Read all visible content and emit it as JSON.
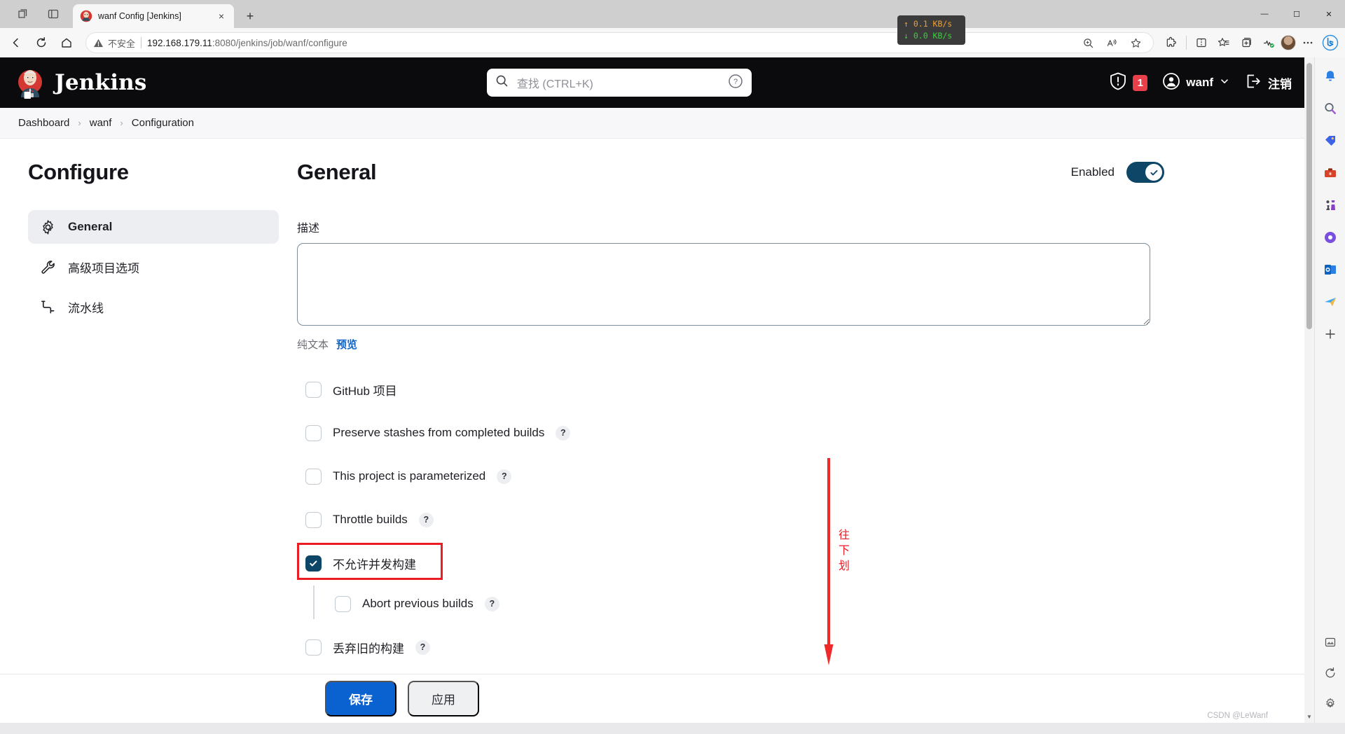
{
  "browser": {
    "tab": {
      "title": "wanf Config [Jenkins]",
      "favicon": "jenkins-icon",
      "close": "×"
    },
    "newtab_label": "+",
    "window_controls": {
      "minimize": "—",
      "maximize": "☐",
      "close": "✕"
    },
    "nav": {
      "back": "back-arrow-icon",
      "refresh": "refresh-icon",
      "home": "home-icon"
    },
    "omnibox": {
      "security_label": "不安全",
      "url_host": "192.168.179.11",
      "url_rest": ":8080/jenkins/job/wanf/configure"
    },
    "network_speed": {
      "upload": "↑ 0.1 KB/s",
      "download": "↓ 0.0 KB/s"
    },
    "toolbar_icons": [
      "zoom-icon",
      "read-aloud-icon",
      "favorite-star-icon",
      "extensions-icon",
      "split-screen-icon",
      "favorites-list-icon",
      "collections-icon",
      "browser-essentials-icon",
      "profile-avatar",
      "settings-more-icon",
      "bing-copilot-icon"
    ]
  },
  "jenkins": {
    "brand": "Jenkins",
    "search": {
      "placeholder": "查找 (CTRL+K)",
      "help": "?"
    },
    "alert_count": "1",
    "user": "wanf",
    "logout": "注销",
    "breadcrumb": [
      "Dashboard",
      "wanf",
      "Configuration"
    ],
    "breadcrumb_sep": "›"
  },
  "sidebar": {
    "title": "Configure",
    "items": [
      {
        "label": "General",
        "icon": "gear-icon",
        "active": true
      },
      {
        "label": "高级项目选项",
        "icon": "wrench-icon",
        "active": false
      },
      {
        "label": "流水线",
        "icon": "pipeline-icon",
        "active": false
      }
    ]
  },
  "main": {
    "heading": "General",
    "enabled_label": "Enabled",
    "enabled_state": true,
    "description_label": "描述",
    "description_value": "",
    "description_plain": "纯文本",
    "description_preview": "预览",
    "checkboxes": [
      {
        "label": "GitHub 项目",
        "checked": false,
        "help": false,
        "nested": false
      },
      {
        "label": "Preserve stashes from completed builds",
        "checked": false,
        "help": true,
        "nested": false
      },
      {
        "label": "This project is parameterized",
        "checked": false,
        "help": true,
        "nested": false
      },
      {
        "label": "Throttle builds",
        "checked": false,
        "help": true,
        "nested": false
      },
      {
        "label": "不允许并发构建",
        "checked": true,
        "help": false,
        "nested": false,
        "highlighted": true
      },
      {
        "label": "Abort previous builds",
        "checked": false,
        "help": true,
        "nested": true
      },
      {
        "label": "丢弃旧的构建",
        "checked": false,
        "help": true,
        "nested": false
      }
    ],
    "help_glyph": "?",
    "buttons": {
      "save": "保存",
      "apply": "应用"
    }
  },
  "annotation": {
    "text": "往下划",
    "color": "#ec1c24"
  },
  "edge_sidebar": {
    "icons": [
      "notification-bell-icon",
      "search-icon",
      "shopping-tag-icon",
      "tools-briefcase-icon",
      "games-icon",
      "office-icon",
      "outlook-icon",
      "send-plane-icon",
      "add-app-icon"
    ],
    "bottom_icons": [
      "image-editor-icon",
      "history-loop-icon",
      "settings-gear-icon"
    ]
  },
  "watermark": "CSDN @LeWanf",
  "colors": {
    "accent_blue": "#0a62d0",
    "toggle_navy": "#0d4667",
    "alert_red": "#e8404a",
    "annotation_red": "#ec1c24",
    "jenkins_header": "#0b0b0d"
  }
}
